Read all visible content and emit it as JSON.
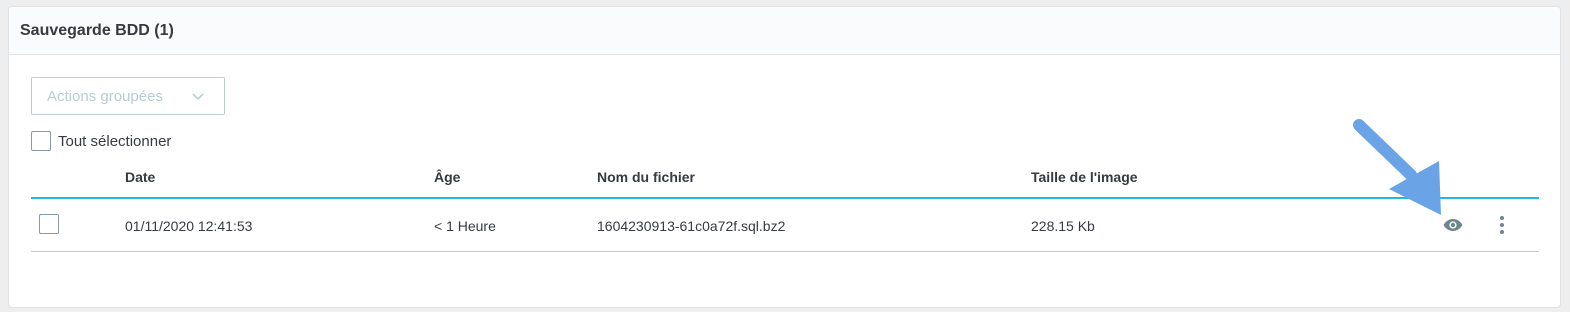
{
  "card": {
    "title": "Sauvegarde BDD (1)"
  },
  "bulk_actions": {
    "label": "Actions groupées"
  },
  "select_all": {
    "label": "Tout sélectionner"
  },
  "table": {
    "columns": [
      "Date",
      "Âge",
      "Nom du fichier",
      "Taille de l'image"
    ],
    "rows": [
      {
        "date": "01/11/2020 12:41:53",
        "age": "< 1 Heure",
        "filename": "1604230913-61c0a72f.sql.bz2",
        "size": "228.15 Kb"
      }
    ]
  },
  "icons": {
    "bulk_chevron": "chevron-down-icon",
    "view": "eye-icon",
    "more": "more-vertical-icon",
    "annotation": "pointer-arrow"
  },
  "colors": {
    "accent": "#25b9d7",
    "border": "#bbcdd2",
    "text": "#363a41",
    "muted": "#b7ced3",
    "icon": "#6c868e",
    "annotation_arrow": "#6aa3e6"
  }
}
